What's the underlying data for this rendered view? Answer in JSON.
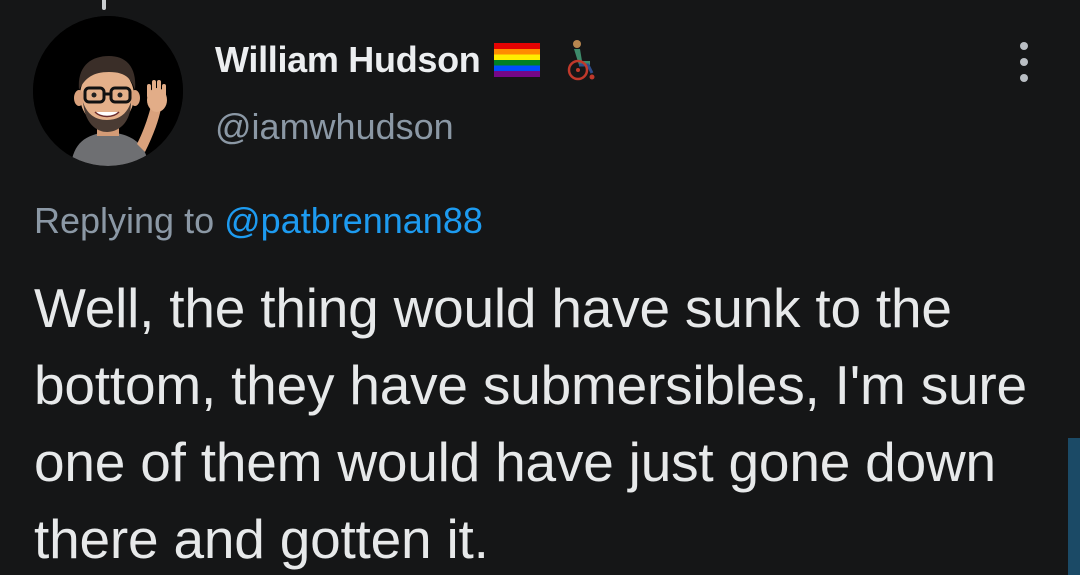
{
  "author": {
    "display_name": "William Hudson",
    "handle": "@iamwhudson",
    "badges": [
      "rainbow-flag-icon",
      "wheelchair-user-icon"
    ]
  },
  "reply": {
    "prefix": "Replying to",
    "to_handle": "@patbrennan88"
  },
  "tweet": {
    "text": "Well, the thing would have sunk to the bottom, they have submersibles, I'm sure one of them would have just gone down there and gotten it."
  },
  "icons": {
    "avatar": "memoji-avatar",
    "more": "more-vertical-icon"
  },
  "colors": {
    "background": "#151617",
    "text_primary": "#e7e9ea",
    "text_secondary": "#8b98a5",
    "link": "#1d9bf0"
  }
}
